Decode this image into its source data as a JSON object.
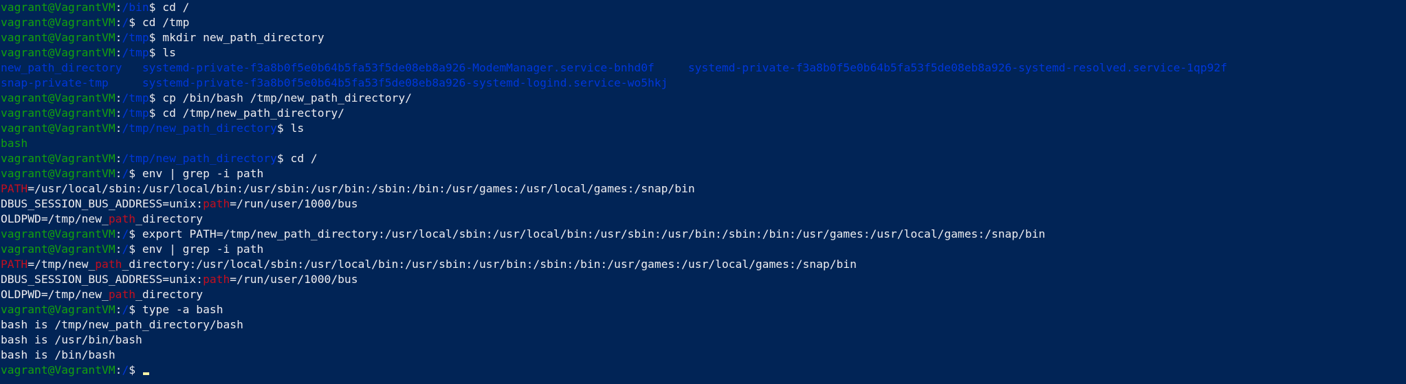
{
  "window": {
    "colors": {
      "background": "#012456",
      "default_text": "#eeedf0",
      "prompt_user": "#13a10e",
      "prompt_path": "#0037da",
      "grep_match": "#c50f1f",
      "dir_listing": "#0037da",
      "exec_file": "#13a10e",
      "cursor": "#f9f1a5"
    }
  },
  "terminal": {
    "lines": [
      {
        "segments": [
          {
            "text": "vagrant@VagrantVM",
            "color": "prompt_user"
          },
          {
            "text": ":",
            "color": "default_text"
          },
          {
            "text": "/bin",
            "color": "prompt_path"
          },
          {
            "text": "$ cd /",
            "color": "default_text"
          }
        ]
      },
      {
        "segments": [
          {
            "text": "vagrant@VagrantVM",
            "color": "prompt_user"
          },
          {
            "text": ":",
            "color": "default_text"
          },
          {
            "text": "/",
            "color": "prompt_path"
          },
          {
            "text": "$ cd /tmp",
            "color": "default_text"
          }
        ]
      },
      {
        "segments": [
          {
            "text": "vagrant@VagrantVM",
            "color": "prompt_user"
          },
          {
            "text": ":",
            "color": "default_text"
          },
          {
            "text": "/tmp",
            "color": "prompt_path"
          },
          {
            "text": "$ mkdir new_path_directory",
            "color": "default_text"
          }
        ]
      },
      {
        "segments": [
          {
            "text": "vagrant@VagrantVM",
            "color": "prompt_user"
          },
          {
            "text": ":",
            "color": "default_text"
          },
          {
            "text": "/tmp",
            "color": "prompt_path"
          },
          {
            "text": "$ ls",
            "color": "default_text"
          }
        ]
      },
      {
        "segments": [
          {
            "text": "new_path_directory   systemd-private-f3a8b0f5e0b64b5fa53f5de08eb8a926-ModemManager.service-bnhd0f     systemd-private-f3a8b0f5e0b64b5fa53f5de08eb8a926-systemd-resolved.service-1qp92f",
            "color": "dir_listing"
          }
        ]
      },
      {
        "segments": [
          {
            "text": "snap-private-tmp     systemd-private-f3a8b0f5e0b64b5fa53f5de08eb8a926-systemd-logind.service-wo5hkj",
            "color": "dir_listing"
          }
        ]
      },
      {
        "segments": [
          {
            "text": "vagrant@VagrantVM",
            "color": "prompt_user"
          },
          {
            "text": ":",
            "color": "default_text"
          },
          {
            "text": "/tmp",
            "color": "prompt_path"
          },
          {
            "text": "$ cp /bin/bash /tmp/new_path_directory/",
            "color": "default_text"
          }
        ]
      },
      {
        "segments": [
          {
            "text": "vagrant@VagrantVM",
            "color": "prompt_user"
          },
          {
            "text": ":",
            "color": "default_text"
          },
          {
            "text": "/tmp",
            "color": "prompt_path"
          },
          {
            "text": "$ cd /tmp/new_path_directory/",
            "color": "default_text"
          }
        ]
      },
      {
        "segments": [
          {
            "text": "vagrant@VagrantVM",
            "color": "prompt_user"
          },
          {
            "text": ":",
            "color": "default_text"
          },
          {
            "text": "/tmp/new_path_directory",
            "color": "prompt_path"
          },
          {
            "text": "$ ls",
            "color": "default_text"
          }
        ]
      },
      {
        "segments": [
          {
            "text": "bash",
            "color": "exec_file"
          }
        ]
      },
      {
        "segments": [
          {
            "text": "vagrant@VagrantVM",
            "color": "prompt_user"
          },
          {
            "text": ":",
            "color": "default_text"
          },
          {
            "text": "/tmp/new_path_directory",
            "color": "prompt_path"
          },
          {
            "text": "$ cd /",
            "color": "default_text"
          }
        ]
      },
      {
        "segments": [
          {
            "text": "vagrant@VagrantVM",
            "color": "prompt_user"
          },
          {
            "text": ":",
            "color": "default_text"
          },
          {
            "text": "/",
            "color": "prompt_path"
          },
          {
            "text": "$ env | grep -i path",
            "color": "default_text"
          }
        ]
      },
      {
        "segments": [
          {
            "text": "PATH",
            "color": "grep_match"
          },
          {
            "text": "=/usr/local/sbin:/usr/local/bin:/usr/sbin:/usr/bin:/sbin:/bin:/usr/games:/usr/local/games:/snap/bin",
            "color": "default_text"
          }
        ]
      },
      {
        "segments": [
          {
            "text": "DBUS_SESSION_BUS_ADDRESS=unix:",
            "color": "default_text"
          },
          {
            "text": "path",
            "color": "grep_match"
          },
          {
            "text": "=/run/user/1000/bus",
            "color": "default_text"
          }
        ]
      },
      {
        "segments": [
          {
            "text": "OLDPWD=/tmp/new_",
            "color": "default_text"
          },
          {
            "text": "path",
            "color": "grep_match"
          },
          {
            "text": "_directory",
            "color": "default_text"
          }
        ]
      },
      {
        "segments": [
          {
            "text": "vagrant@VagrantVM",
            "color": "prompt_user"
          },
          {
            "text": ":",
            "color": "default_text"
          },
          {
            "text": "/",
            "color": "prompt_path"
          },
          {
            "text": "$ export PATH=/tmp/new_path_directory:/usr/local/sbin:/usr/local/bin:/usr/sbin:/usr/bin:/sbin:/bin:/usr/games:/usr/local/games:/snap/bin",
            "color": "default_text"
          }
        ]
      },
      {
        "segments": [
          {
            "text": "vagrant@VagrantVM",
            "color": "prompt_user"
          },
          {
            "text": ":",
            "color": "default_text"
          },
          {
            "text": "/",
            "color": "prompt_path"
          },
          {
            "text": "$ env | grep -i path",
            "color": "default_text"
          }
        ]
      },
      {
        "segments": [
          {
            "text": "PATH",
            "color": "grep_match"
          },
          {
            "text": "=/tmp/new_",
            "color": "default_text"
          },
          {
            "text": "path",
            "color": "grep_match"
          },
          {
            "text": "_directory:/usr/local/sbin:/usr/local/bin:/usr/sbin:/usr/bin:/sbin:/bin:/usr/games:/usr/local/games:/snap/bin",
            "color": "default_text"
          }
        ]
      },
      {
        "segments": [
          {
            "text": "DBUS_SESSION_BUS_ADDRESS=unix:",
            "color": "default_text"
          },
          {
            "text": "path",
            "color": "grep_match"
          },
          {
            "text": "=/run/user/1000/bus",
            "color": "default_text"
          }
        ]
      },
      {
        "segments": [
          {
            "text": "OLDPWD=/tmp/new_",
            "color": "default_text"
          },
          {
            "text": "path",
            "color": "grep_match"
          },
          {
            "text": "_directory",
            "color": "default_text"
          }
        ]
      },
      {
        "segments": [
          {
            "text": "vagrant@VagrantVM",
            "color": "prompt_user"
          },
          {
            "text": ":",
            "color": "default_text"
          },
          {
            "text": "/",
            "color": "prompt_path"
          },
          {
            "text": "$ type -a bash",
            "color": "default_text"
          }
        ]
      },
      {
        "segments": [
          {
            "text": "bash is /tmp/new_path_directory/bash",
            "color": "default_text"
          }
        ]
      },
      {
        "segments": [
          {
            "text": "bash is /usr/bin/bash",
            "color": "default_text"
          }
        ]
      },
      {
        "segments": [
          {
            "text": "bash is /bin/bash",
            "color": "default_text"
          }
        ]
      },
      {
        "segments": [
          {
            "text": "vagrant@VagrantVM",
            "color": "prompt_user"
          },
          {
            "text": ":",
            "color": "default_text"
          },
          {
            "text": "/",
            "color": "prompt_path"
          },
          {
            "text": "$ ",
            "color": "default_text"
          }
        ],
        "cursor": true
      }
    ]
  }
}
